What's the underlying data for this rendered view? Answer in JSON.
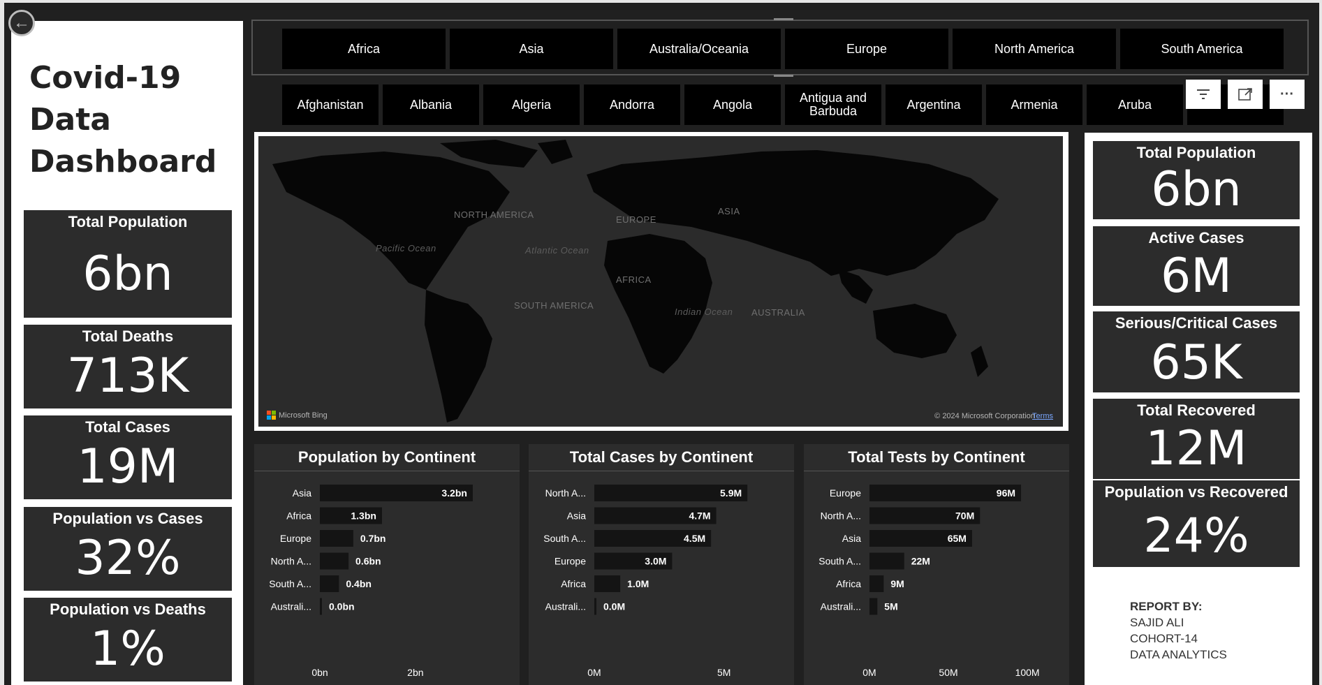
{
  "title": "Covid-19 Data Dashboard",
  "left_kpis": [
    {
      "label": "Total Population",
      "value": "6bn"
    },
    {
      "label": "Total Deaths",
      "value": "713K"
    },
    {
      "label": "Total Cases",
      "value": "19M"
    },
    {
      "label": "Population vs Cases",
      "value": "32%"
    },
    {
      "label": "Population vs Deaths",
      "value": "1%"
    }
  ],
  "right_kpis": [
    {
      "label": "Total Population",
      "value": "6bn"
    },
    {
      "label": "Active Cases",
      "value": "6M"
    },
    {
      "label": "Serious/Critical Cases",
      "value": "65K"
    },
    {
      "label": "Total Recovered",
      "value": "12M"
    },
    {
      "label": "Population vs Recovered",
      "value": "24%"
    }
  ],
  "continents": [
    "Africa",
    "Asia",
    "Australia/Oceania",
    "Europe",
    "North America",
    "South America"
  ],
  "countries": [
    "Afghanistan",
    "Albania",
    "Algeria",
    "Andorra",
    "Angola",
    "Antigua and Barbuda",
    "Argentina",
    "Armenia",
    "Aruba"
  ],
  "toolbar": {
    "filter_icon": "filter-icon",
    "focus_icon": "focus-mode-icon",
    "more_icon": "more-options-icon",
    "more_label": "···"
  },
  "map": {
    "labels": {
      "north_america": "NORTH AMERICA",
      "europe": "EUROPE",
      "asia": "ASIA",
      "pacific": "Pacific Ocean",
      "atlantic": "Atlantic Ocean",
      "africa": "AFRICA",
      "south_america": "SOUTH AMERICA",
      "indian": "Indian Ocean",
      "australia": "AUSTRALIA"
    },
    "logo": "Microsoft Bing",
    "copyright": "© 2024 Microsoft Corporation",
    "terms": "Terms",
    "colors": {
      "land": "#060606",
      "water": "#2b2b2b"
    }
  },
  "chart_data": [
    {
      "type": "bar",
      "title": "Population by Continent",
      "categories": [
        "Asia",
        "Africa",
        "Europe",
        "North A...",
        "South A...",
        "Australi..."
      ],
      "values": [
        3.2,
        1.3,
        0.7,
        0.6,
        0.4,
        0.0
      ],
      "value_labels": [
        "3.2bn",
        "1.3bn",
        "0.7bn",
        "0.6bn",
        "0.4bn",
        "0.0bn"
      ],
      "unit": "bn",
      "xlim": [
        0,
        3.8
      ],
      "ticks": [
        {
          "v": 0,
          "label": "0bn"
        },
        {
          "v": 2,
          "label": "2bn"
        }
      ],
      "bar_color": "#141414"
    },
    {
      "type": "bar",
      "title": "Total Cases by Continent",
      "categories": [
        "North A...",
        "Asia",
        "South A...",
        "Europe",
        "Africa",
        "Australi..."
      ],
      "values": [
        5.9,
        4.7,
        4.5,
        3.0,
        1.0,
        0.0
      ],
      "value_labels": [
        "5.9M",
        "4.7M",
        "4.5M",
        "3.0M",
        "1.0M",
        "0.0M"
      ],
      "unit": "M",
      "xlim": [
        0,
        7
      ],
      "ticks": [
        {
          "v": 0,
          "label": "0M"
        },
        {
          "v": 5,
          "label": "5M"
        }
      ],
      "bar_color": "#141414"
    },
    {
      "type": "bar",
      "title": "Total Tests by Continent",
      "categories": [
        "Europe",
        "North A...",
        "Asia",
        "South A...",
        "Africa",
        "Australi..."
      ],
      "values": [
        96,
        70,
        65,
        22,
        9,
        5
      ],
      "value_labels": [
        "96M",
        "70M",
        "65M",
        "22M",
        "9M",
        "5M"
      ],
      "unit": "M",
      "xlim": [
        0,
        115
      ],
      "ticks": [
        {
          "v": 0,
          "label": "0M"
        },
        {
          "v": 50,
          "label": "50M"
        },
        {
          "v": 100,
          "label": "100M"
        }
      ],
      "bar_color": "#141414"
    }
  ],
  "report": {
    "heading": "REPORT BY:",
    "name": "SAJID ALI",
    "cohort": "COHORT-14",
    "track": "DATA ANALYTICS"
  }
}
